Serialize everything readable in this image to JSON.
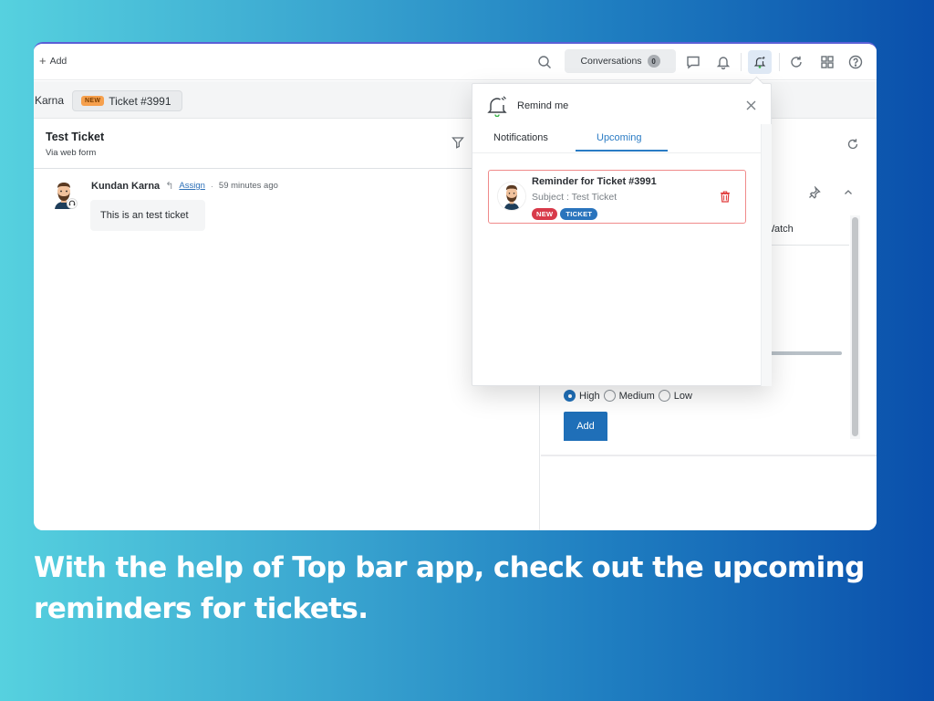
{
  "topbar": {
    "add_label": "Add",
    "conversations_label": "Conversations",
    "conversations_count": "0",
    "icons": [
      "search-icon",
      "chat-icon",
      "bell-icon",
      "remind-bell-icon",
      "refresh-icon",
      "apps-grid-icon",
      "help-icon"
    ]
  },
  "tabs": [
    {
      "label": "Karna"
    },
    {
      "badge": "NEW",
      "label": "Ticket #3991",
      "active": true
    }
  ],
  "ticket": {
    "title": "Test Ticket",
    "source": "Via web form"
  },
  "message": {
    "author": "Kundan Karna",
    "assign_label": "Assign",
    "separator": "·",
    "time": "59 minutes ago",
    "body": "This is an test ticket"
  },
  "right_panel": {
    "watch_tab": "Watch",
    "priority_options": [
      {
        "label": "High",
        "selected": true
      },
      {
        "label": "Medium",
        "selected": false
      },
      {
        "label": "Low",
        "selected": false
      }
    ],
    "add_button": "Add"
  },
  "popover": {
    "title": "Remind me",
    "tabs": [
      {
        "label": "Notifications",
        "active": false
      },
      {
        "label": "Upcoming",
        "active": true
      }
    ],
    "reminders": [
      {
        "title": "Reminder for Ticket #3991",
        "subject": "Subject : Test Ticket",
        "badges": [
          "NEW",
          "TICKET"
        ]
      }
    ]
  },
  "caption": {
    "line1": "With the help of Top bar app, check out the upcoming",
    "line2": "reminders for tickets."
  },
  "colors": {
    "accent": "#1f6fb8",
    "tab_active": "#2a7bc4",
    "badge_new": "#d83a4a",
    "badge_ticket": "#2a74bd",
    "tab_badge_new": "#f6a04d",
    "card_border": "#f08a8a"
  }
}
